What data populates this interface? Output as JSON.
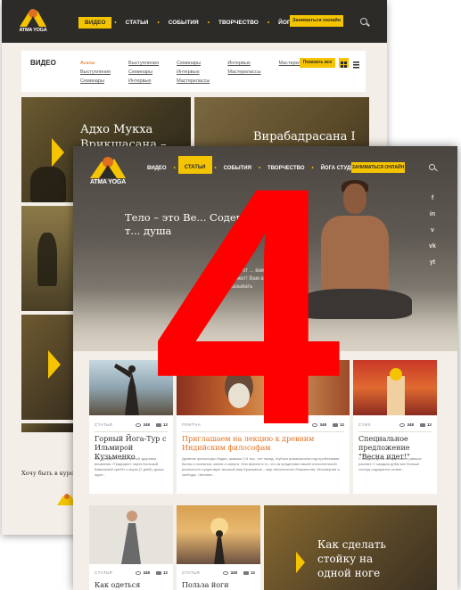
{
  "logo": {
    "text": "ATMA YOGA"
  },
  "back_window": {
    "nav": {
      "items": [
        "ВИДЕО",
        "СТАТЬИ",
        "СОБЫТИЯ",
        "ТВОРЧЕСТВО",
        "ЙОГА СТУДИЯ"
      ],
      "active": "ВИДЕО",
      "cta": "Заниматься онлайн"
    },
    "filter": {
      "heading": "ВИДЕО",
      "columns": [
        [
          "Асаны",
          "Выступления",
          "Семинары"
        ],
        [
          "Выступления",
          "Семинары",
          "Интервью"
        ],
        [
          "Семинары",
          "Интервью",
          "Мастерклассы"
        ],
        [
          "Интервью",
          "Мастерклассы"
        ],
        [
          "Мастерклассы"
        ]
      ],
      "selected": "Асаны",
      "show_all": "Показать все"
    },
    "cards": [
      {
        "title": "Адхо Мукха Врикшасана –"
      },
      {
        "title": "Вирабадрасана I"
      }
    ],
    "footer_text": "Хочу быть в курсе"
  },
  "front_window": {
    "nav": {
      "items": [
        "ВИДЕО",
        "СТАТЬИ",
        "СОБЫТИЯ",
        "ТВОРЧЕСТВО",
        "ЙОГА СТУДИЯ"
      ],
      "active": "СТАТЬИ",
      "cta": "ЗАНИМАТЬСЯ ОНЛАЙН"
    },
    "social": [
      "f",
      "in",
      "v",
      "vk",
      "yt"
    ],
    "hero": {
      "title": "Тело – это Ве... Содержит... ведь т... душа",
      "subtitle": "...поможет йогу от ... вам. Наши ... поможет! Вам в ... будет подсказывать"
    },
    "cards": [
      {
        "category": "СТАТЬЯ",
        "views": "348",
        "comments": "12",
        "title": "Горный Йога-Тур с Ильмирой Кузьменко",
        "body": "Мы пройдём с вами тропой здоровья внимания «Традиции» через Большой Кавказский хребет к морю (7 дней), дыша один..."
      },
      {
        "category": "ПРИТЧА",
        "views": "348",
        "comments": "12",
        "title": "Приглашаем на лекцию к древним Индийским философам",
        "body": "Древние философы Индии, жившие 2,5 тыс. лет назад, глубоко размышляли над проблемами бытия и сознания, жизни и смерти. Они верили в то, что за пределами нашей относительной реальности существует высший мир Брахманов – мир абсолютного блаженства, бессмертия и свободы. Человек..."
      },
      {
        "category": "СТИХ",
        "views": "348",
        "comments": "12",
        "title": "Специальное предложение \"Весна идет!\"",
        "body": "С каждым днём все раньше и раньше рассвет. С каждым днём все больше солнца ощущается отсвет..."
      }
    ],
    "cards_row2": [
      {
        "category": "СТАТЬЯ",
        "views": "348",
        "comments": "12",
        "title": "Как одеться"
      },
      {
        "category": "СТАТЬЯ",
        "views": "348",
        "comments": "12",
        "title": "Польза йоги"
      }
    ],
    "big_card": {
      "title": "Как сделать стойку на одной ноге"
    }
  },
  "overlay": {
    "numeral": "4",
    "color": "#ff0000"
  },
  "colors": {
    "accent": "#f5c400",
    "dark": "#2d2b28",
    "orange": "#e07020"
  }
}
